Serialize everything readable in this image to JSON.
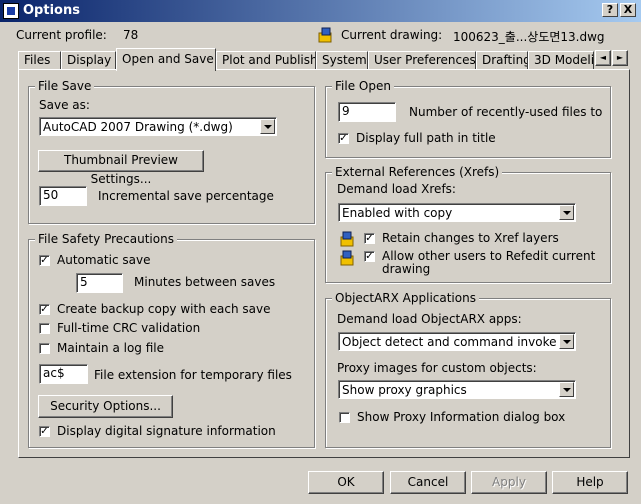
{
  "window": {
    "title": "Options",
    "help_btn": "?",
    "close_btn": "X"
  },
  "header": {
    "current_profile_label": "Current profile:",
    "current_profile_value": "78",
    "current_drawing_label": "Current drawing:",
    "current_drawing_value": "100623_출...상도면13.dwg"
  },
  "tabs": [
    {
      "label": "Files"
    },
    {
      "label": "Display"
    },
    {
      "label": "Open and Save"
    },
    {
      "label": "Plot and Publish"
    },
    {
      "label": "System"
    },
    {
      "label": "User Preferences"
    },
    {
      "label": "Drafting"
    },
    {
      "label": "3D Modeling"
    }
  ],
  "tab_scroll": {
    "left": "◄",
    "right": "►"
  },
  "file_save": {
    "title": "File Save",
    "save_as_label": "Save as:",
    "save_as_value": "AutoCAD 2007 Drawing (*.dwg)",
    "thumbnail_button": "Thumbnail Preview Settings...",
    "incremental_value": "50",
    "incremental_label": "Incremental save percentage"
  },
  "file_safety": {
    "title": "File Safety Precautions",
    "automatic_save": "Automatic save",
    "automatic_save_checked": true,
    "minutes_value": "5",
    "minutes_label": "Minutes between saves",
    "backup": "Create backup copy with each save",
    "backup_checked": true,
    "crc": "Full-time CRC validation",
    "crc_checked": false,
    "log": "Maintain a log file",
    "log_checked": false,
    "ext_value": "ac$",
    "ext_label": "File extension for temporary files",
    "security_button": "Security Options...",
    "digital_sig": "Display digital signature information",
    "digital_sig_checked": true
  },
  "file_open": {
    "title": "File Open",
    "recent_value": "9",
    "recent_label": "Number of recently-used files to",
    "full_path": "Display full path in title",
    "full_path_checked": true
  },
  "xrefs": {
    "title": "External References (Xrefs)",
    "demand_label": "Demand load Xrefs:",
    "demand_value": "Enabled with copy",
    "retain": "Retain changes to Xref layers",
    "retain_checked": true,
    "allow_line1": "Allow other users to Refedit current",
    "allow_line2": "drawing",
    "allow_checked": true
  },
  "objectarx": {
    "title": "ObjectARX Applications",
    "demand_label": "Demand load ObjectARX apps:",
    "demand_value": "Object detect and command invoke",
    "proxy_label": "Proxy images for custom objects:",
    "proxy_value": "Show proxy graphics",
    "show_proxy_info": "Show Proxy Information dialog box",
    "show_proxy_info_checked": false
  },
  "footer": {
    "ok": "OK",
    "cancel": "Cancel",
    "apply": "Apply",
    "help": "Help"
  }
}
